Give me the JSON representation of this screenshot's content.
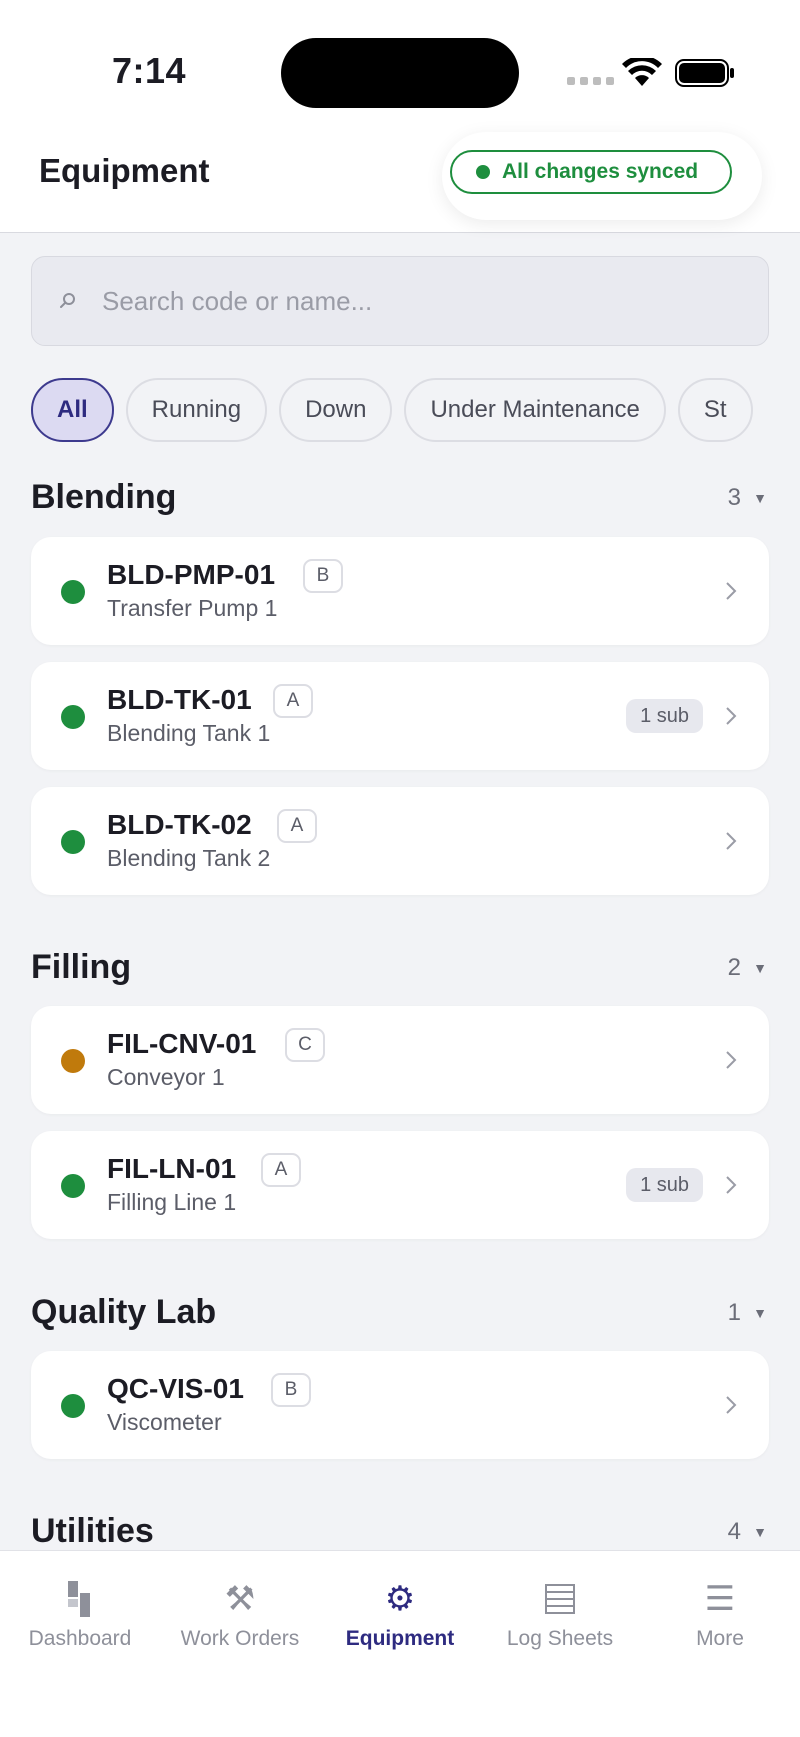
{
  "status_bar": {
    "time": "7:14"
  },
  "header": {
    "title": "Equipment",
    "sync_status": "All changes synced",
    "sync_color": "#1e8e3e"
  },
  "search": {
    "placeholder": "Search code or name..."
  },
  "filters": [
    {
      "label": "All",
      "active": true
    },
    {
      "label": "Running",
      "active": false
    },
    {
      "label": "Down",
      "active": false
    },
    {
      "label": "Under Maintenance",
      "active": false
    },
    {
      "label": "St",
      "active": false
    }
  ],
  "sections": [
    {
      "title": "Blending",
      "count": "3",
      "items": [
        {
          "code": "BLD-PMP-01",
          "criticality": "B",
          "name": "Transfer Pump 1",
          "status": "running",
          "sub": ""
        },
        {
          "code": "BLD-TK-01",
          "criticality": "A",
          "name": "Blending Tank 1",
          "status": "running",
          "sub": "1 sub"
        },
        {
          "code": "BLD-TK-02",
          "criticality": "A",
          "name": "Blending Tank 2",
          "status": "running",
          "sub": ""
        }
      ]
    },
    {
      "title": "Filling",
      "count": "2",
      "items": [
        {
          "code": "FIL-CNV-01",
          "criticality": "C",
          "name": "Conveyor 1",
          "status": "warn",
          "sub": ""
        },
        {
          "code": "FIL-LN-01",
          "criticality": "A",
          "name": "Filling Line 1",
          "status": "running",
          "sub": "1 sub"
        }
      ]
    },
    {
      "title": "Quality Lab",
      "count": "1",
      "items": [
        {
          "code": "QC-VIS-01",
          "criticality": "B",
          "name": "Viscometer",
          "status": "running",
          "sub": ""
        }
      ]
    },
    {
      "title": "Utilities",
      "count": "4",
      "items": []
    }
  ],
  "tabs": [
    {
      "label": "Dashboard",
      "icon": "dashboard-icon"
    },
    {
      "label": "Work Orders",
      "icon": "tools-icon"
    },
    {
      "label": "Equipment",
      "icon": "gear-icon",
      "active": true
    },
    {
      "label": "Log Sheets",
      "icon": "log-sheet-icon"
    },
    {
      "label": "More",
      "icon": "menu-icon"
    }
  ],
  "colors": {
    "accent": "#2e2b80",
    "running": "#1e8e3e",
    "warning": "#c07a0c"
  }
}
